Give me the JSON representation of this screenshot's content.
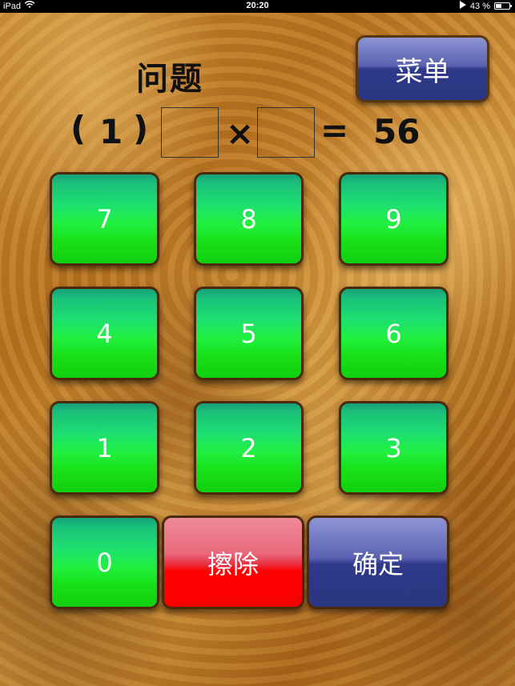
{
  "status_bar": {
    "device": "iPad",
    "time": "20:20",
    "battery": "43 %"
  },
  "header": {
    "title": "问题",
    "menu_label": "菜单"
  },
  "equation": {
    "open_paren": "(",
    "index": "1",
    "close_paren": ")",
    "multiply": "×",
    "equals": "=",
    "result": "56"
  },
  "keypad": {
    "k7": "7",
    "k8": "8",
    "k9": "9",
    "k4": "4",
    "k5": "5",
    "k6": "6",
    "k1": "1",
    "k2": "2",
    "k3": "3",
    "k0": "0",
    "erase": "擦除",
    "confirm": "确定"
  },
  "colors": {
    "key_green": "#20f040",
    "erase_red": "#ff0000",
    "confirm_blue": "#2e3a8a"
  }
}
